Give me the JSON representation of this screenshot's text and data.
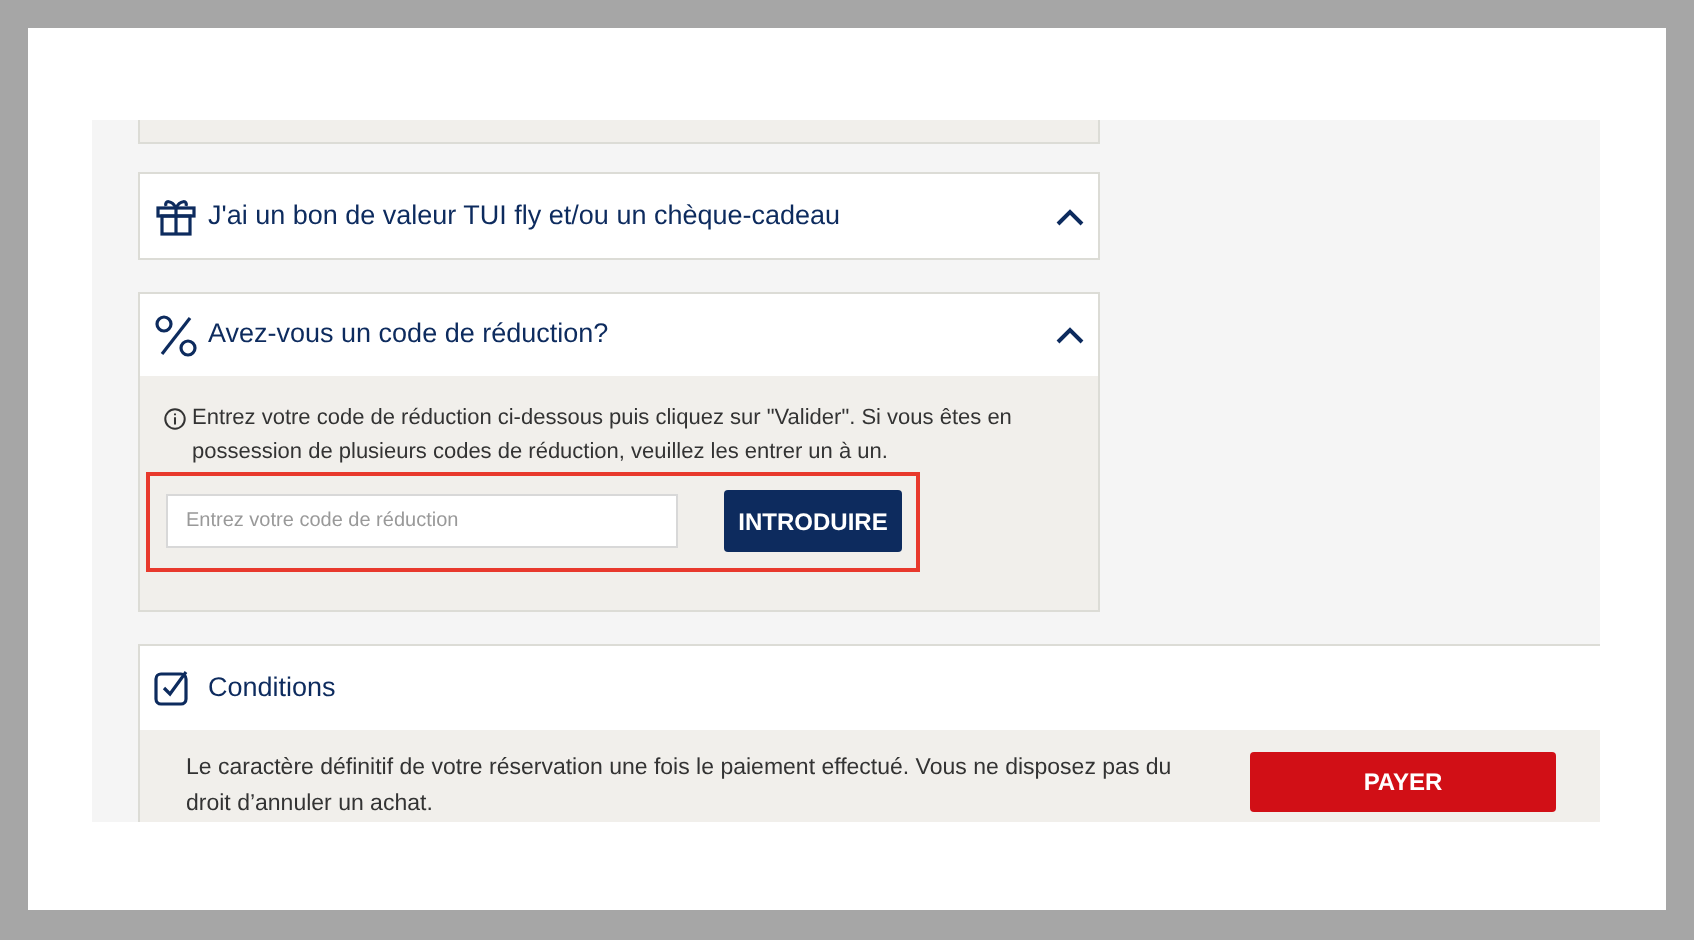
{
  "gift_panel": {
    "title": "J'ai un bon de valeur TUI fly et/ou un chèque-cadeau"
  },
  "discount_panel": {
    "title": "Avez-vous un code de réduction?",
    "info": "Entrez votre code de réduction ci-dessous puis cliquez sur \"Valider\". Si vous êtes en possession de plusieurs codes de réduction, veuillez les entrer un à un.",
    "field": {
      "placeholder": "Entrez votre code de réduction"
    },
    "button": "INTRODUIRE"
  },
  "conditions_panel": {
    "title": "Conditions",
    "text": "Le caractère définitif de votre réservation une fois le paiement effectué. Vous ne disposez pas du droit d’annuler un achat.",
    "button": "PAYER"
  }
}
